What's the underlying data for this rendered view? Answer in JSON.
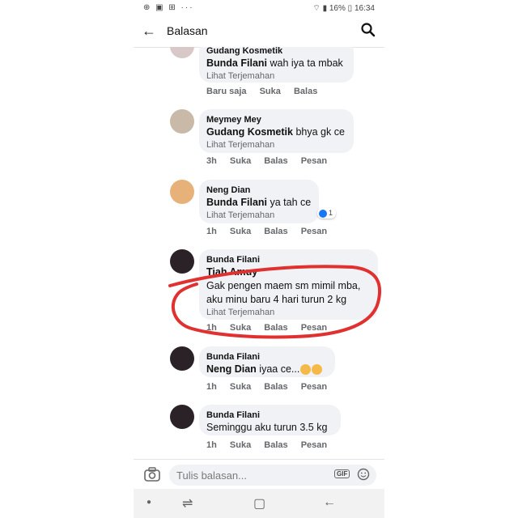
{
  "status": {
    "left_icons": "⊕ ▣ ⊞  ···",
    "battery": "16%",
    "time": "16:34"
  },
  "appbar": {
    "title": "Balasan"
  },
  "comments": [
    {
      "author": "Gudang Kosmetik",
      "mention": "Bunda Filani",
      "text": "wah iya ta mbak",
      "translate": "Lihat Terjemahan",
      "time": "Baru saja",
      "like": "Suka",
      "reply": "Balas"
    },
    {
      "author": "Meymey Mey",
      "mention": "Gudang Kosmetik",
      "text": "bhya gk ce",
      "translate": "Lihat Terjemahan",
      "time": "3h",
      "like": "Suka",
      "reply": "Balas",
      "message": "Pesan"
    },
    {
      "author": "Neng Dian",
      "mention": "Bunda Filani",
      "text": "ya tah ce",
      "translate": "Lihat Terjemahan",
      "time": "1h",
      "like": "Suka",
      "reply": "Balas",
      "message": "Pesan",
      "reaction_count": "1"
    },
    {
      "author": "Bunda Filani",
      "mention": "Tiah Amuy",
      "text_line1": "Gak pengen maem sm mimil mba,",
      "text_line2": "aku minu baru 4 hari turun 2 kg",
      "translate": "Lihat Terjemahan",
      "time": "1h",
      "like": "Suka",
      "reply": "Balas",
      "message": "Pesan"
    },
    {
      "author": "Bunda Filani",
      "mention": "Neng Dian",
      "text": "iyaa ce...",
      "time": "1h",
      "like": "Suka",
      "reply": "Balas",
      "message": "Pesan"
    },
    {
      "author": "Bunda Filani",
      "text": "Seminggu aku turun 3.5 kg",
      "time": "1h",
      "like": "Suka",
      "reply": "Balas",
      "message": "Pesan"
    }
  ],
  "composer": {
    "placeholder": "Tulis balasan...",
    "gif_label": "GIF"
  },
  "colors": {
    "accent": "#1877f2",
    "bubble": "#f0f2f5",
    "annotation": "#e03030"
  }
}
